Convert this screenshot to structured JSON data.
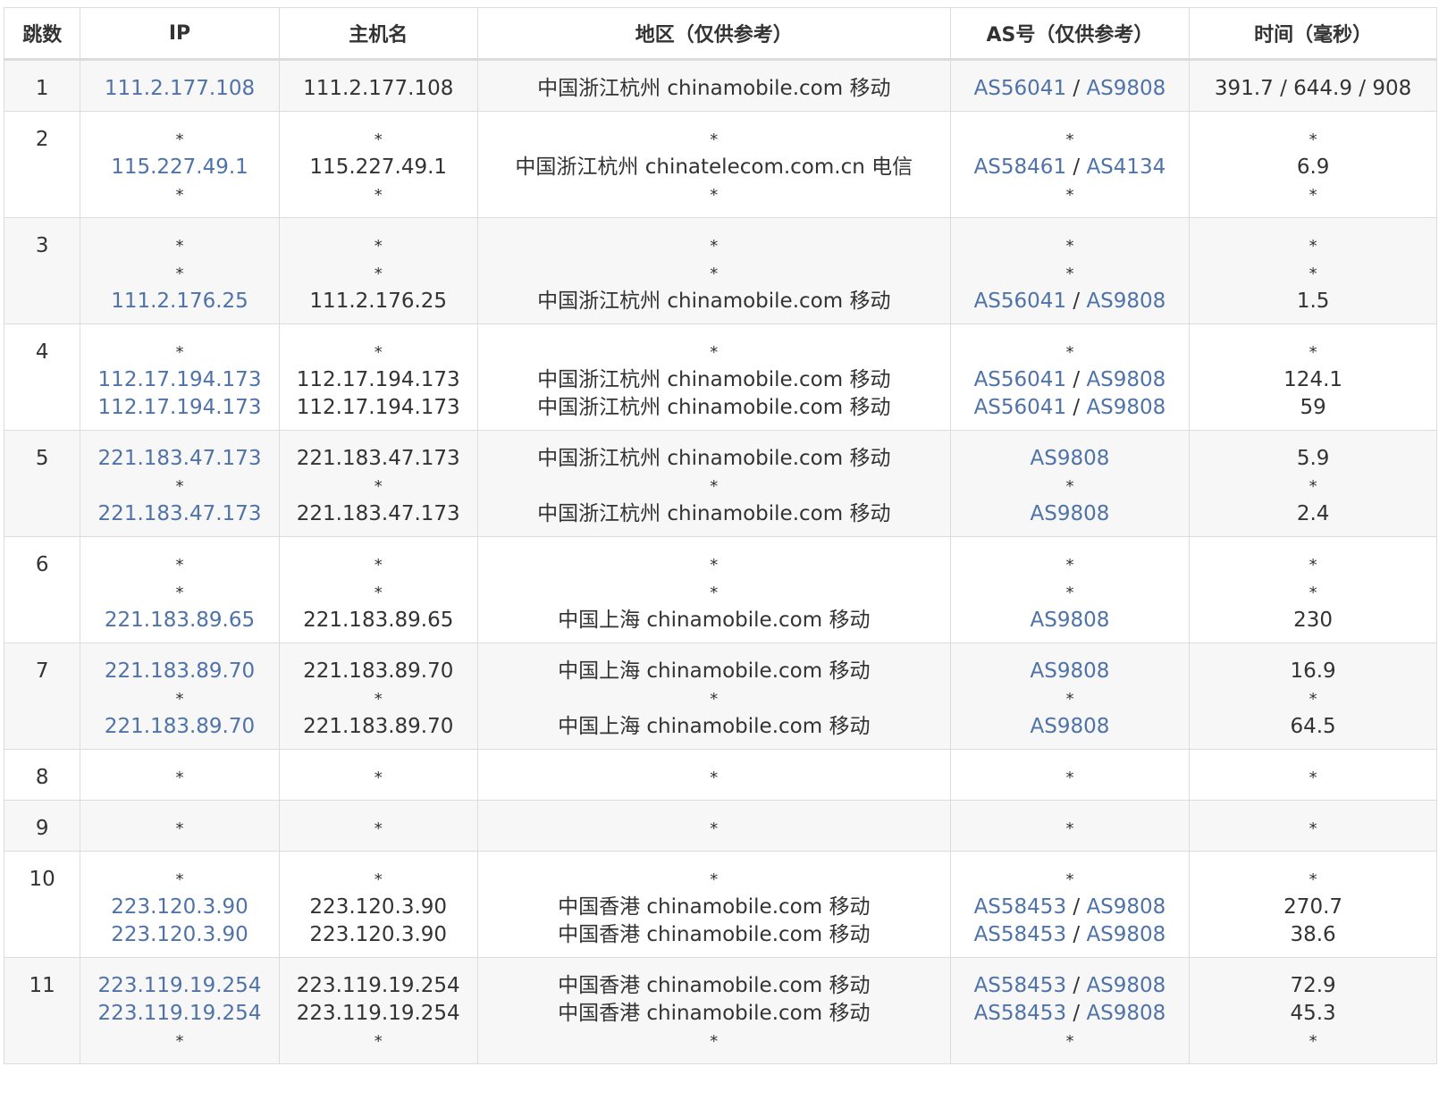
{
  "columns": [
    "跳数",
    "IP",
    "主机名",
    "地区（仅供参考）",
    "AS号（仅供参考）",
    "时间（毫秒）"
  ],
  "rows": [
    {
      "hop": "1",
      "entries": [
        {
          "ip": "111.2.177.108",
          "host": "111.2.177.108",
          "region": "中国浙江杭州 chinamobile.com 移动",
          "as": [
            "AS56041",
            "AS9808"
          ],
          "time": "391.7 / 644.9 / 908"
        }
      ]
    },
    {
      "hop": "2",
      "entries": [
        {
          "ip": "*",
          "host": "*",
          "region": "*",
          "as": [],
          "time": "*"
        },
        {
          "ip": "115.227.49.1",
          "host": "115.227.49.1",
          "region": "中国浙江杭州 chinatelecom.com.cn 电信",
          "as": [
            "AS58461",
            "AS4134"
          ],
          "time": "6.9"
        },
        {
          "ip": "*",
          "host": "*",
          "region": "*",
          "as": [],
          "time": "*"
        }
      ]
    },
    {
      "hop": "3",
      "entries": [
        {
          "ip": "*",
          "host": "*",
          "region": "*",
          "as": [],
          "time": "*"
        },
        {
          "ip": "*",
          "host": "*",
          "region": "*",
          "as": [],
          "time": "*"
        },
        {
          "ip": "111.2.176.25",
          "host": "111.2.176.25",
          "region": "中国浙江杭州 chinamobile.com 移动",
          "as": [
            "AS56041",
            "AS9808"
          ],
          "time": "1.5"
        }
      ]
    },
    {
      "hop": "4",
      "entries": [
        {
          "ip": "*",
          "host": "*",
          "region": "*",
          "as": [],
          "time": "*"
        },
        {
          "ip": "112.17.194.173",
          "host": "112.17.194.173",
          "region": "中国浙江杭州 chinamobile.com 移动",
          "as": [
            "AS56041",
            "AS9808"
          ],
          "time": "124.1"
        },
        {
          "ip": "112.17.194.173",
          "host": "112.17.194.173",
          "region": "中国浙江杭州 chinamobile.com 移动",
          "as": [
            "AS56041",
            "AS9808"
          ],
          "time": "59"
        }
      ]
    },
    {
      "hop": "5",
      "entries": [
        {
          "ip": "221.183.47.173",
          "host": "221.183.47.173",
          "region": "中国浙江杭州 chinamobile.com 移动",
          "as": [
            "AS9808"
          ],
          "time": "5.9"
        },
        {
          "ip": "*",
          "host": "*",
          "region": "*",
          "as": [],
          "time": "*"
        },
        {
          "ip": "221.183.47.173",
          "host": "221.183.47.173",
          "region": "中国浙江杭州 chinamobile.com 移动",
          "as": [
            "AS9808"
          ],
          "time": "2.4"
        }
      ]
    },
    {
      "hop": "6",
      "entries": [
        {
          "ip": "*",
          "host": "*",
          "region": "*",
          "as": [],
          "time": "*"
        },
        {
          "ip": "*",
          "host": "*",
          "region": "*",
          "as": [],
          "time": "*"
        },
        {
          "ip": "221.183.89.65",
          "host": "221.183.89.65",
          "region": "中国上海 chinamobile.com 移动",
          "as": [
            "AS9808"
          ],
          "time": "230"
        }
      ]
    },
    {
      "hop": "7",
      "entries": [
        {
          "ip": "221.183.89.70",
          "host": "221.183.89.70",
          "region": "中国上海 chinamobile.com 移动",
          "as": [
            "AS9808"
          ],
          "time": "16.9"
        },
        {
          "ip": "*",
          "host": "*",
          "region": "*",
          "as": [],
          "time": "*"
        },
        {
          "ip": "221.183.89.70",
          "host": "221.183.89.70",
          "region": "中国上海 chinamobile.com 移动",
          "as": [
            "AS9808"
          ],
          "time": "64.5"
        }
      ]
    },
    {
      "hop": "8",
      "entries": [
        {
          "ip": "*",
          "host": "*",
          "region": "*",
          "as": [],
          "time": "*"
        }
      ]
    },
    {
      "hop": "9",
      "entries": [
        {
          "ip": "*",
          "host": "*",
          "region": "*",
          "as": [],
          "time": "*"
        }
      ]
    },
    {
      "hop": "10",
      "entries": [
        {
          "ip": "*",
          "host": "*",
          "region": "*",
          "as": [],
          "time": "*"
        },
        {
          "ip": "223.120.3.90",
          "host": "223.120.3.90",
          "region": "中国香港 chinamobile.com 移动",
          "as": [
            "AS58453",
            "AS9808"
          ],
          "time": "270.7"
        },
        {
          "ip": "223.120.3.90",
          "host": "223.120.3.90",
          "region": "中国香港 chinamobile.com 移动",
          "as": [
            "AS58453",
            "AS9808"
          ],
          "time": "38.6"
        }
      ]
    },
    {
      "hop": "11",
      "entries": [
        {
          "ip": "223.119.19.254",
          "host": "223.119.19.254",
          "region": "中国香港 chinamobile.com 移动",
          "as": [
            "AS58453",
            "AS9808"
          ],
          "time": "72.9"
        },
        {
          "ip": "223.119.19.254",
          "host": "223.119.19.254",
          "region": "中国香港 chinamobile.com 移动",
          "as": [
            "AS58453",
            "AS9808"
          ],
          "time": "45.3"
        },
        {
          "ip": "*",
          "host": "*",
          "region": "*",
          "as": [],
          "time": "*"
        }
      ]
    }
  ]
}
